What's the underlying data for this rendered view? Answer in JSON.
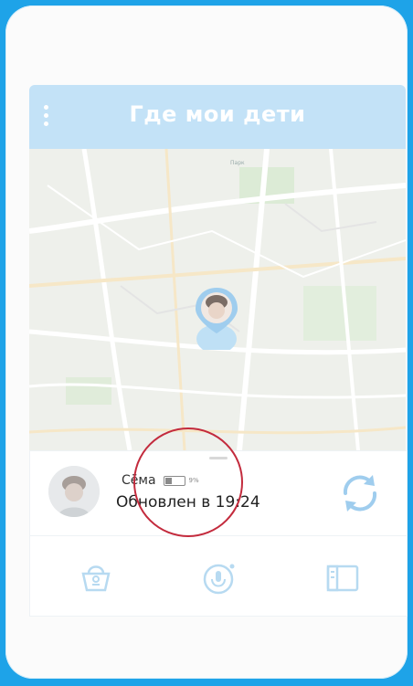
{
  "app": {
    "title": "Где мои дети",
    "menu_icon": "menu-icon"
  },
  "map": {
    "place_labels": [
      "Парк"
    ]
  },
  "child": {
    "name": "Сёма",
    "battery_percent_label": "9%",
    "battery_level": 0.4,
    "status_text": "Обновлен в 19:24",
    "avatar_icon": "child-avatar"
  },
  "tabs": [
    {
      "name": "basket-icon"
    },
    {
      "name": "microphone-icon"
    },
    {
      "name": "screen-icon"
    }
  ],
  "colors": {
    "frame": "#1ea3e8",
    "appbar": "#c3e2f7",
    "accent": "#8ec8ef",
    "highlight": "#c32b3d"
  }
}
